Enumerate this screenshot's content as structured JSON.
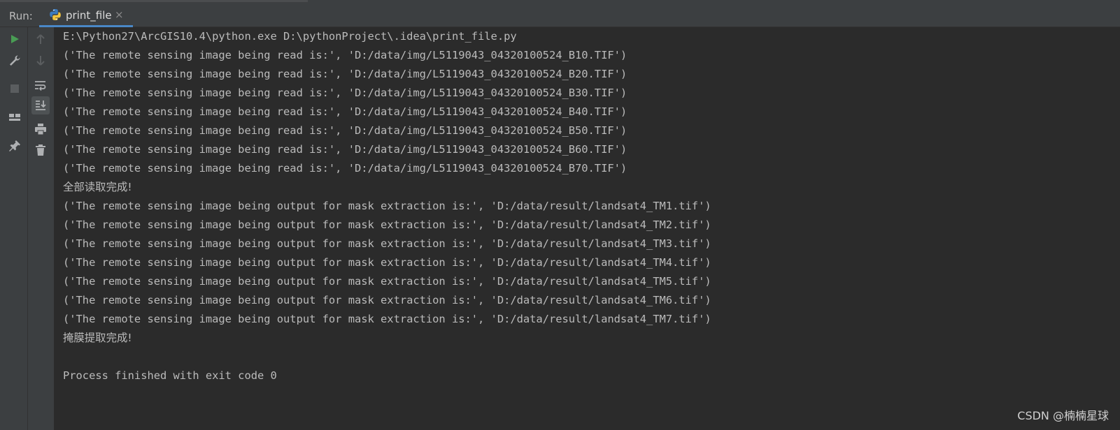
{
  "header": {
    "run_label": "Run:",
    "tab_label": "print_file",
    "tab_close": "×",
    "accent": "#4a88c7"
  },
  "toolbar_icons": [
    "rerun-icon",
    "wrench-icon",
    "stop-icon",
    "layout-icon",
    "pin-icon",
    "up-arrow-icon",
    "down-arrow-icon",
    "soft-wrap-icon",
    "scroll-to-end-icon",
    "print-icon",
    "trash-icon"
  ],
  "console": {
    "lines": [
      "E:\\Python27\\ArcGIS10.4\\python.exe D:\\pythonProject\\.idea\\print_file.py",
      "('The remote sensing image being read is:', 'D:/data/img/L5119043_04320100524_B10.TIF')",
      "('The remote sensing image being read is:', 'D:/data/img/L5119043_04320100524_B20.TIF')",
      "('The remote sensing image being read is:', 'D:/data/img/L5119043_04320100524_B30.TIF')",
      "('The remote sensing image being read is:', 'D:/data/img/L5119043_04320100524_B40.TIF')",
      "('The remote sensing image being read is:', 'D:/data/img/L5119043_04320100524_B50.TIF')",
      "('The remote sensing image being read is:', 'D:/data/img/L5119043_04320100524_B60.TIF')",
      "('The remote sensing image being read is:', 'D:/data/img/L5119043_04320100524_B70.TIF')",
      "全部读取完成!",
      "('The remote sensing image being output for mask extraction is:', 'D:/data/result/landsat4_TM1.tif')",
      "('The remote sensing image being output for mask extraction is:', 'D:/data/result/landsat4_TM2.tif')",
      "('The remote sensing image being output for mask extraction is:', 'D:/data/result/landsat4_TM3.tif')",
      "('The remote sensing image being output for mask extraction is:', 'D:/data/result/landsat4_TM4.tif')",
      "('The remote sensing image being output for mask extraction is:', 'D:/data/result/landsat4_TM5.tif')",
      "('The remote sensing image being output for mask extraction is:', 'D:/data/result/landsat4_TM6.tif')",
      "('The remote sensing image being output for mask extraction is:', 'D:/data/result/landsat4_TM7.tif')",
      "掩膜提取完成!",
      "",
      "Process finished with exit code 0"
    ]
  },
  "watermark": "CSDN @楠楠星球"
}
